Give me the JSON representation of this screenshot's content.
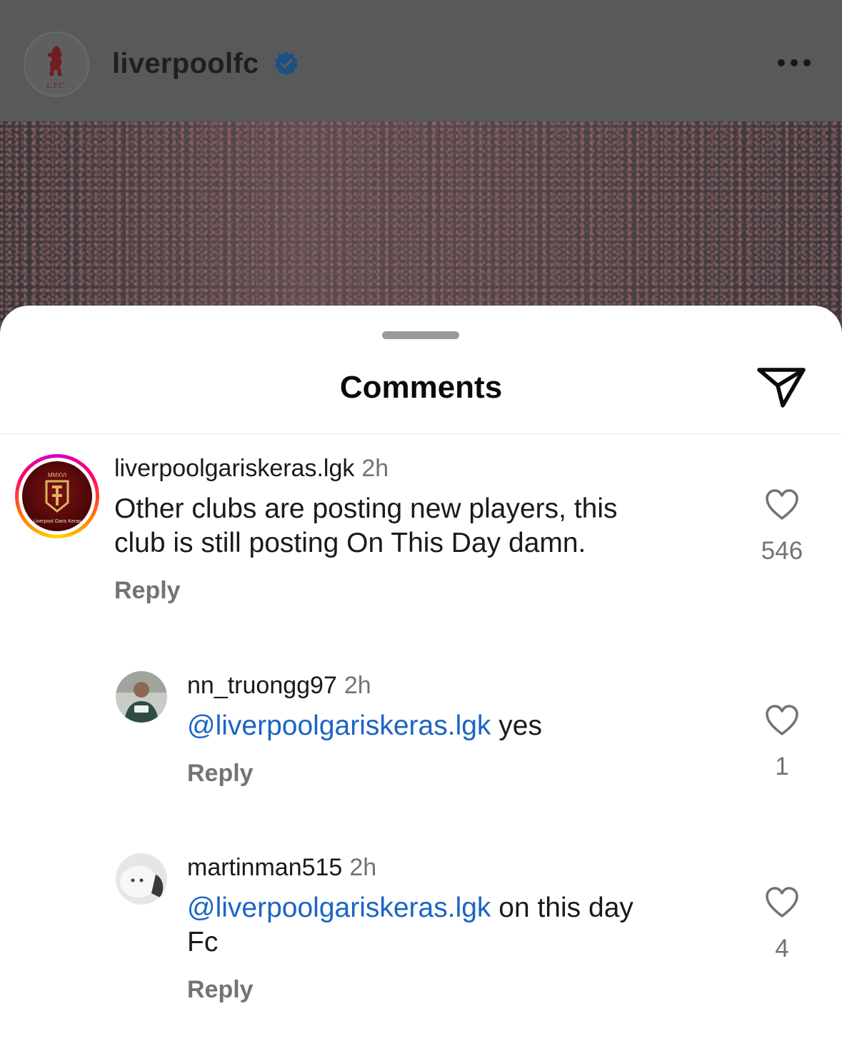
{
  "post_header": {
    "account_name": "liverpoolfc",
    "logo_text": "L.F.C.",
    "verified": true,
    "more_icon": "ellipsis-icon"
  },
  "sheet": {
    "title": "Comments",
    "share_icon": "send-icon"
  },
  "comments": [
    {
      "username": "liverpoolgariskeras.lgk",
      "time": "2h",
      "text": "Other clubs are posting new players, this",
      "text_line2": "club is still posting On This Day damn.",
      "likes": "546",
      "reply_label": "Reply",
      "avatar_top_text": "MMXVI",
      "avatar_bottom_text": "Liverpool Garis Keras"
    },
    {
      "username": "nn_truongg97",
      "time": "2h",
      "mention": "@liverpoolgariskeras.lgk",
      "text": " yes",
      "likes": "1",
      "reply_label": "Reply"
    },
    {
      "username": "martinman515",
      "time": "2h",
      "mention": "@liverpoolgariskeras.lgk",
      "text": " on this day",
      "text_line2": "Fc",
      "likes": "4",
      "reply_label": "Reply"
    }
  ],
  "colors": {
    "mention": "#1c64c4",
    "secondary_text": "#737373",
    "verified_badge": "#1d6fd8"
  }
}
